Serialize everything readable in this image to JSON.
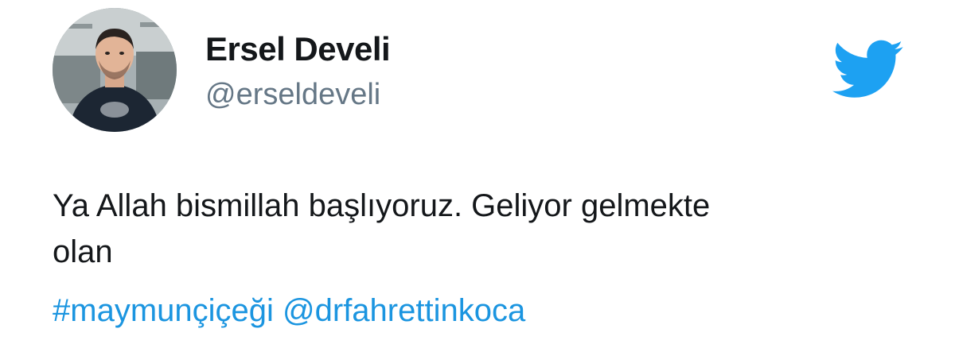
{
  "author": {
    "display_name": "Ersel Develi",
    "username": "@erseldeveli",
    "avatar_icon": "profile-photo"
  },
  "brand": {
    "icon": "twitter-bird-icon",
    "color": "#1da1f2"
  },
  "tweet": {
    "text_line_1": "Ya Allah bismillah başlıyoruz. Geliyor gelmekte",
    "text_line_2": "olan",
    "hashtag": "#maymunçiçeği",
    "mention": "@drfahrettinkoca",
    "link_color": "#1b95e0"
  }
}
